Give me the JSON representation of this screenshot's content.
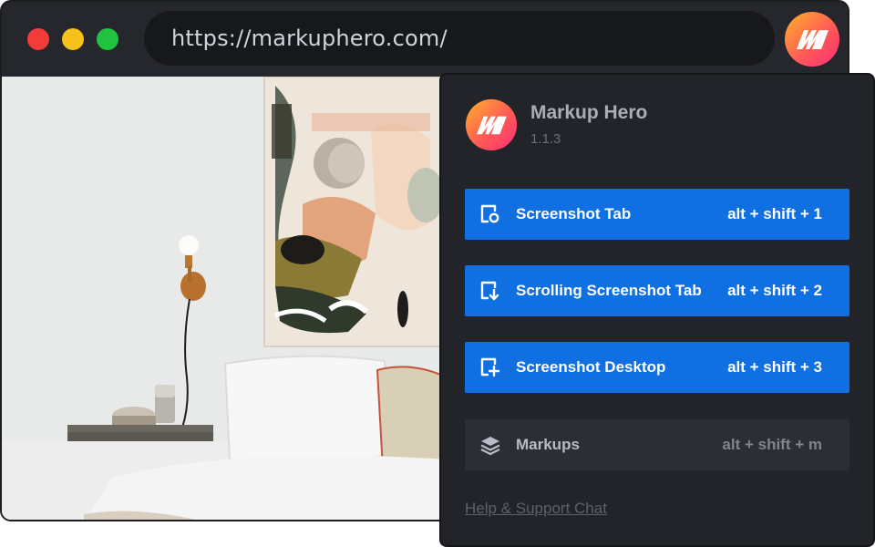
{
  "browser": {
    "url": "https://markuphero.com/"
  },
  "popup": {
    "app_name": "Markup Hero",
    "version": "1.1.3",
    "actions": [
      {
        "label": "Screenshot Tab",
        "shortcut": "alt + shift + 1",
        "icon": "screenshot-tab-icon"
      },
      {
        "label": "Scrolling Screenshot Tab",
        "shortcut": "alt + shift + 2",
        "icon": "scrolling-screenshot-icon"
      },
      {
        "label": "Screenshot Desktop",
        "shortcut": "alt + shift + 3",
        "icon": "screenshot-desktop-icon"
      },
      {
        "label": "Markups",
        "shortcut": "alt + shift + m",
        "icon": "layers-icon"
      }
    ],
    "help_link": "Help & Support Chat"
  },
  "colors": {
    "accent_blue": "#1170e1",
    "popup_bg": "#22242a",
    "logo_gradient_start": "#ffb02a",
    "logo_gradient_end": "#ff3b6b",
    "traffic_red": "#f23b3b",
    "traffic_yellow": "#f5c21b",
    "traffic_green": "#22c241"
  }
}
